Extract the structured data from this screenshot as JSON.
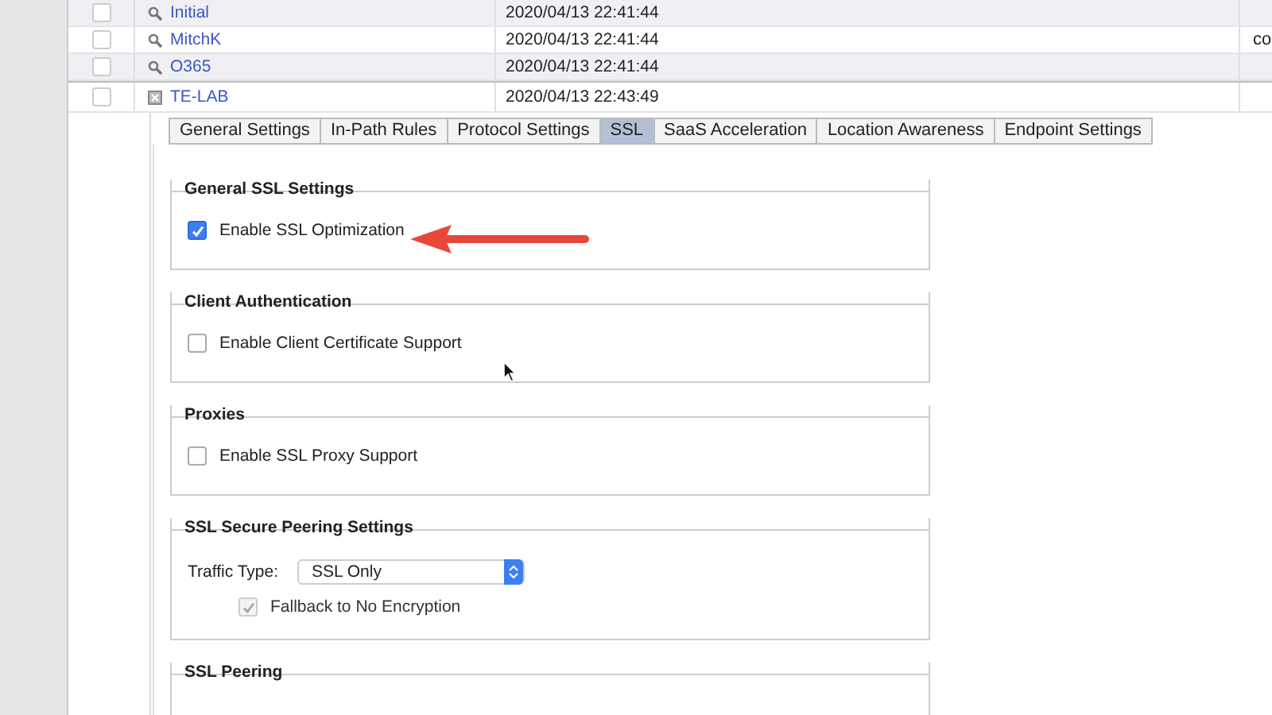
{
  "table": {
    "rows": [
      {
        "checked": false,
        "kind": "search",
        "name": "Initial",
        "date": "2020/04/13 22:41:44",
        "column_4": ""
      },
      {
        "checked": false,
        "kind": "search",
        "name": "MitchK",
        "date": "2020/04/13 22:41:44",
        "column_4": "co"
      },
      {
        "checked": false,
        "kind": "search",
        "name": "O365",
        "date": "2020/04/13 22:41:44",
        "column_4": ""
      },
      {
        "checked": false,
        "kind": "error",
        "name": "TE-LAB",
        "date": "2020/04/13 22:43:49",
        "column_4": ""
      }
    ]
  },
  "tabs": [
    {
      "label": "General Settings",
      "selected": false
    },
    {
      "label": "In-Path Rules",
      "selected": false
    },
    {
      "label": "Protocol Settings",
      "selected": false
    },
    {
      "label": "SSL",
      "selected": true
    },
    {
      "label": "SaaS Acceleration",
      "selected": false
    },
    {
      "label": "Location Awareness",
      "selected": false
    },
    {
      "label": "Endpoint Settings",
      "selected": false
    }
  ],
  "sections": [
    {
      "title": "General SSL Settings",
      "items": [
        {
          "kind": "checkbox",
          "label": "Enable SSL Optimization",
          "checked": true,
          "disabled": false
        }
      ]
    },
    {
      "title": "Client Authentication",
      "items": [
        {
          "kind": "checkbox",
          "label": "Enable Client Certificate Support",
          "checked": false,
          "disabled": false
        }
      ]
    },
    {
      "title": "Proxies",
      "items": [
        {
          "kind": "checkbox",
          "label": "Enable SSL Proxy Support",
          "checked": false,
          "disabled": false
        }
      ]
    },
    {
      "title": "SSL Secure Peering Settings",
      "items": [
        {
          "kind": "select",
          "label": "Traffic Type:",
          "value": "SSL Only"
        },
        {
          "kind": "checkbox",
          "label": "Fallback to No Encryption",
          "checked": true,
          "disabled": true
        }
      ]
    },
    {
      "title": "SSL Peering"
    }
  ]
}
